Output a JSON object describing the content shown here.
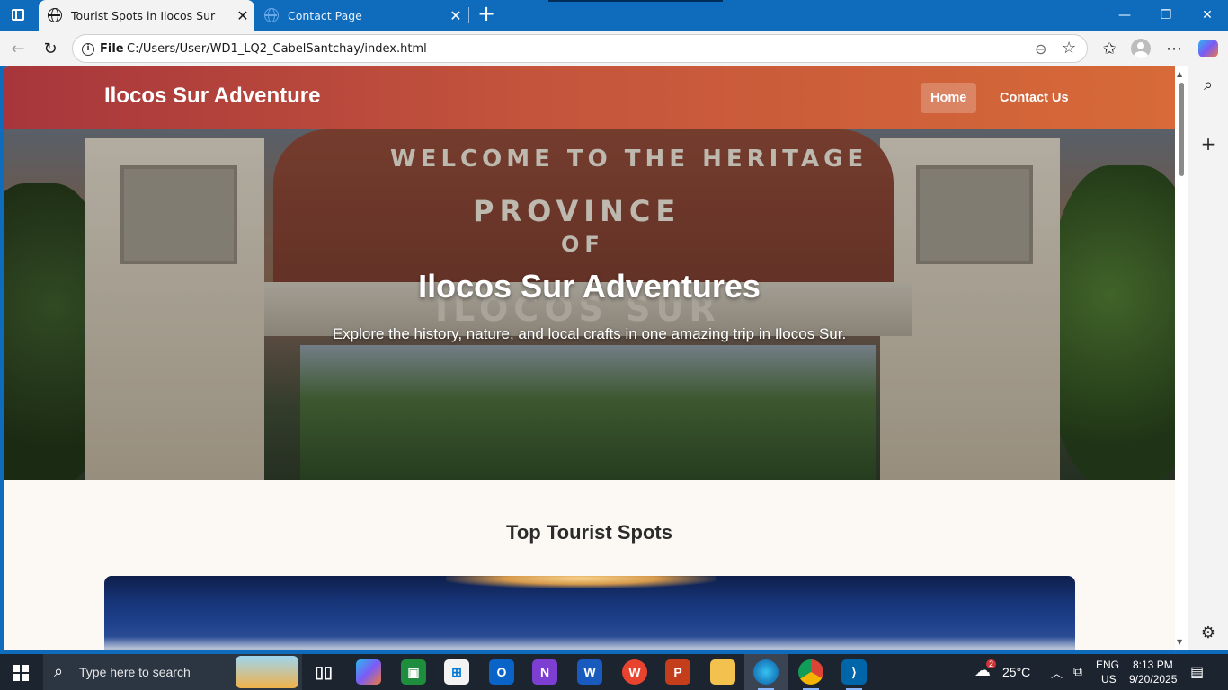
{
  "browser": {
    "tabs": [
      {
        "title": "Tourist Spots in Ilocos Sur",
        "active": true
      },
      {
        "title": "Contact Page",
        "active": false
      }
    ],
    "address": {
      "scheme": "File",
      "url": "C:/Users/User/WD1_LQ2_CabelSantchay/index.html"
    }
  },
  "site": {
    "logo": "Ilocos Sur Adventure",
    "nav": [
      {
        "label": "Home",
        "active": true
      },
      {
        "label": "Contact Us",
        "active": false
      }
    ],
    "hero": {
      "title": "Ilocos Sur Adventures",
      "subtitle": "Explore the history, nature, and local crafts in one amazing trip in Ilocos Sur.",
      "sign_line1": "WELCOME TO THE HERITAGE",
      "sign_line2": "PROVINCE",
      "sign_line3": "OF",
      "sign_line4": "ILOCOS SUR"
    },
    "section_title": "Top Tourist Spots"
  },
  "taskbar": {
    "search_placeholder": "Type here to search",
    "weather_badge": "2",
    "temperature": "25°C",
    "lang_top": "ENG",
    "lang_bottom": "US",
    "time": "8:13 PM",
    "date": "9/20/2025"
  },
  "colors": {
    "header_start": "#a7363c",
    "header_end": "#d76a38",
    "browser_accent": "#0f6cbd",
    "page_bg": "#fcf9f5"
  }
}
